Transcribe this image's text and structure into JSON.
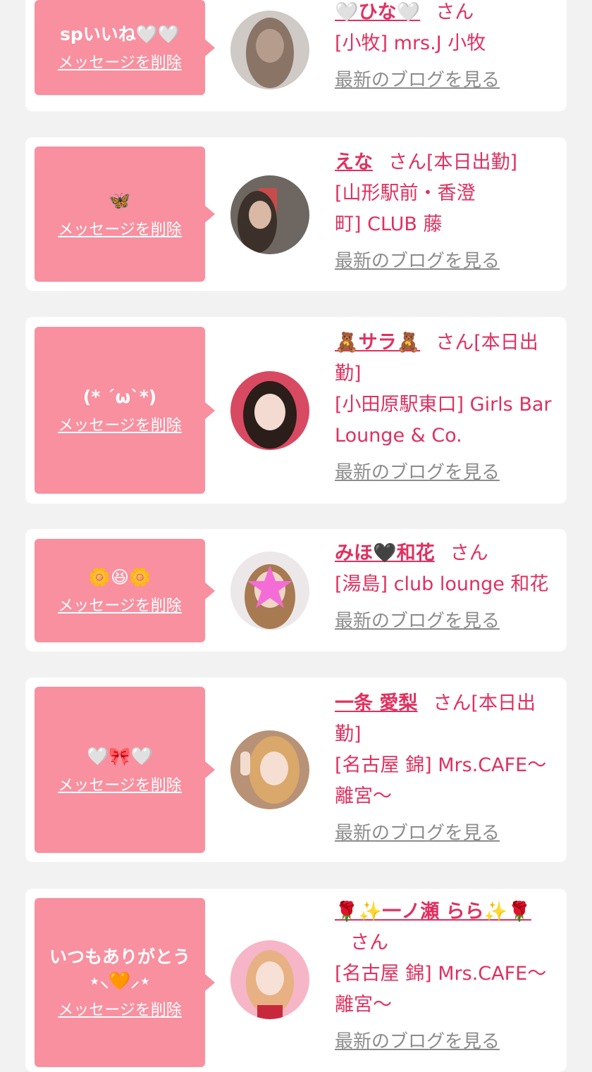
{
  "colors": {
    "bubble": "#f8909f",
    "accent": "#e0305f",
    "link_gray": "#8c8c8c",
    "background": "#f2f2f2"
  },
  "labels": {
    "delete": "メッセージを削除",
    "san": "さん",
    "blog": "最新のブログを見る"
  },
  "items": [
    {
      "message": "spいいね🤍🤍",
      "name": "🤍ひな🤍",
      "status": "",
      "shop": "[小牧] mrs.J 小牧",
      "avatar_icon": "girl-long-hair-avatar"
    },
    {
      "message": "🦋",
      "name": "えな",
      "status": "[本日出勤]",
      "shop": "[山形駅前・香澄町] CLUB 藤",
      "avatar_icon": "girl-selfie-avatar"
    },
    {
      "message": "(* ´ω`*)",
      "name": "🧸サラ🧸",
      "status": "[本日出勤]",
      "shop": "[小田原駅東口] Girls Bar Lounge & Co.",
      "avatar_icon": "girl-portrait-avatar"
    },
    {
      "message": "🌼😆🌼",
      "name": "みほ🖤和花",
      "status": "",
      "shop": "[湯島] club lounge 和花",
      "avatar_icon": "star-masked-avatar"
    },
    {
      "message": "🤍🎀🤍",
      "name": "一条 愛梨",
      "status": "[本日出勤]",
      "shop": "[名古屋 錦] Mrs.CAFE〜離宮〜",
      "avatar_icon": "peace-sign-avatar"
    },
    {
      "message": "いつもありがとう\n⋆⸜🧡⸝⋆",
      "name": "🌹✨一ノ瀬 らら✨🌹",
      "status": "",
      "shop": "[名古屋 錦] Mrs.CAFE〜離宮〜",
      "avatar_icon": "pink-room-avatar"
    }
  ]
}
